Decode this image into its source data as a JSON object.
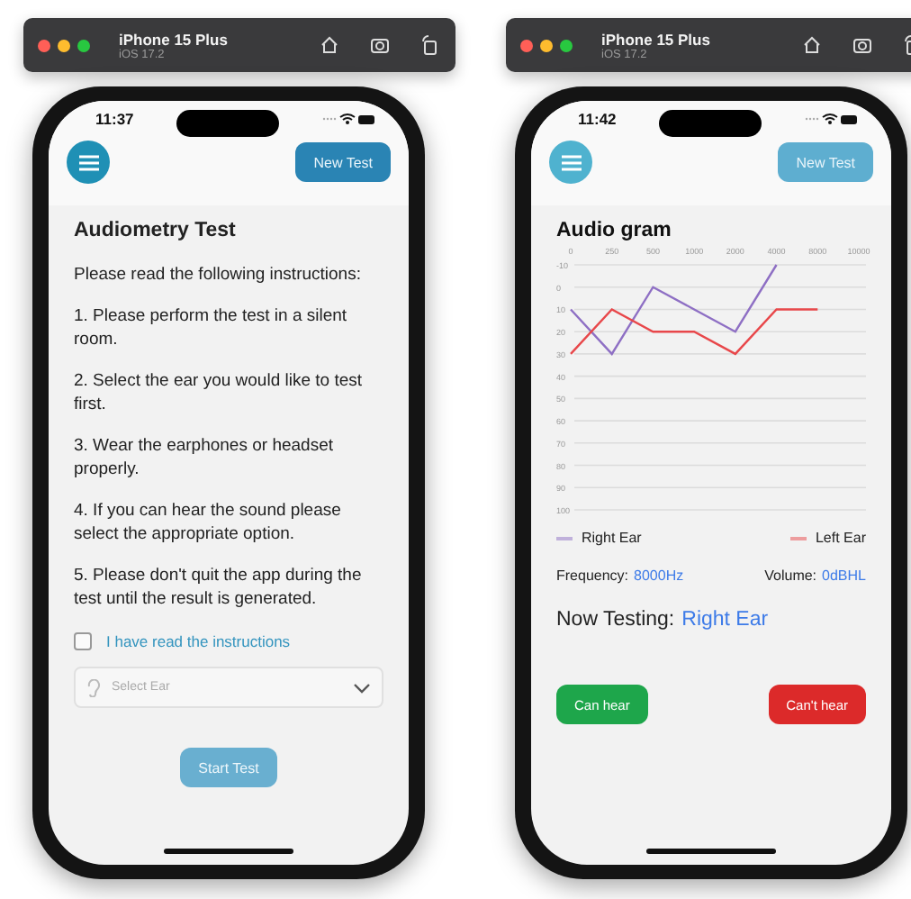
{
  "simulators": [
    {
      "device": "iPhone 15 Plus",
      "os": "iOS 17.2",
      "screen": {
        "kind": "instructions",
        "time": "11:37",
        "new_test_button": {
          "label": "New Test",
          "disabled": false
        },
        "title": "Audiometry Test",
        "intro": "Please read the following instructions:",
        "instructions": [
          "1. Please perform the test in a silent room.",
          "2. Select the ear you would like to test first.",
          "3. Wear the earphones or headset properly.",
          "4. If you can hear the sound please select the appropriate option.",
          "5. Please don't quit the app during the test until the result is generated."
        ],
        "agreement": {
          "label": "I have read the instructions",
          "checked": false
        },
        "ear_select": {
          "placeholder": "Select Ear"
        },
        "start_button": {
          "label": "Start Test",
          "disabled": true
        }
      }
    },
    {
      "device": "iPhone 15 Plus",
      "os": "iOS 17.2",
      "screen": {
        "kind": "audiogram",
        "time": "11:42",
        "new_test_button": {
          "label": "New Test",
          "disabled": true
        },
        "title": "Audio gram",
        "chart_data": {
          "type": "line",
          "grid": true,
          "categories": [
            "0",
            "250",
            "500",
            "1000",
            "2000",
            "4000",
            "8000",
            "10000"
          ],
          "ylim": [
            100,
            -10
          ],
          "yticks": [
            -10,
            0,
            10,
            20,
            30,
            40,
            50,
            60,
            70,
            80,
            90,
            100
          ],
          "series": [
            {
              "name": "Right Ear",
              "color": "#8e6fc4",
              "values": [
                10,
                30,
                0,
                10,
                20,
                -10,
                null,
                null
              ]
            },
            {
              "name": "Left Ear",
              "color": "#e8474a",
              "values": [
                30,
                10,
                20,
                20,
                30,
                10,
                10,
                null
              ]
            }
          ]
        },
        "readings": [
          {
            "label": "Frequency:",
            "value": "8000Hz"
          },
          {
            "label": "Volume:",
            "value": "0dBHL"
          }
        ],
        "now_testing": {
          "label": "Now Testing:",
          "value": "Right Ear"
        },
        "answer_buttons": [
          {
            "label": "Can hear",
            "kind": "yes"
          },
          {
            "label": "Can't hear",
            "kind": "no"
          }
        ]
      }
    }
  ]
}
